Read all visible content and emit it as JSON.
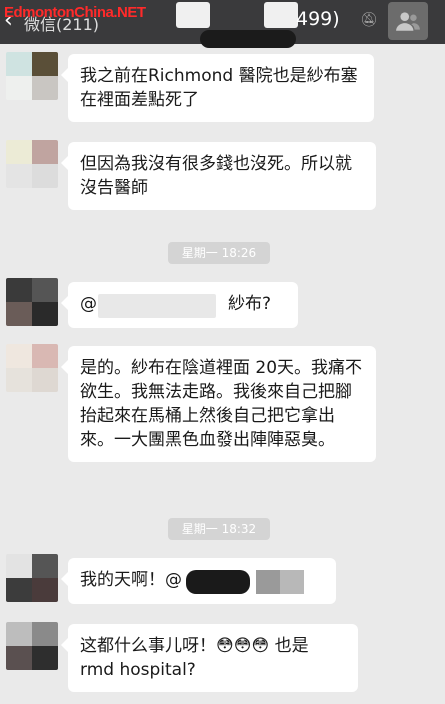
{
  "header": {
    "watermark": "EdmontonChina.NET",
    "back_label": "微信(211)",
    "member_count": "499)",
    "mute_icon": "mute-icon",
    "group_icon": "group-avatar-icon"
  },
  "messages": [
    {
      "text": "我之前在Richmond 醫院也是紗布塞在裡面差點死了"
    },
    {
      "text": "但因為我沒有很多錢也沒死。所以就沒告醫師"
    },
    {
      "time": "星期一 18:26"
    },
    {
      "text_prefix": "@",
      "text_suffix": "紗布?"
    },
    {
      "text": "是的。紗布在陰道裡面 20天。我痛不欲生。我無法走路。我後來自己把腳抬起來在馬桶上然後自己把它拿出來。一大團黑色血發出陣陣惡臭。"
    },
    {
      "time": "星期一 18:32"
    },
    {
      "text": "我的天啊！@"
    },
    {
      "text": "这都什么事儿呀！😳😳😳 也是 rmd hospital?"
    }
  ],
  "colors": {
    "header_bg": "#3a3a3c",
    "chat_bg": "#eaeaea",
    "bubble_bg": "#ffffff",
    "time_pill": "#d4d4d4"
  }
}
